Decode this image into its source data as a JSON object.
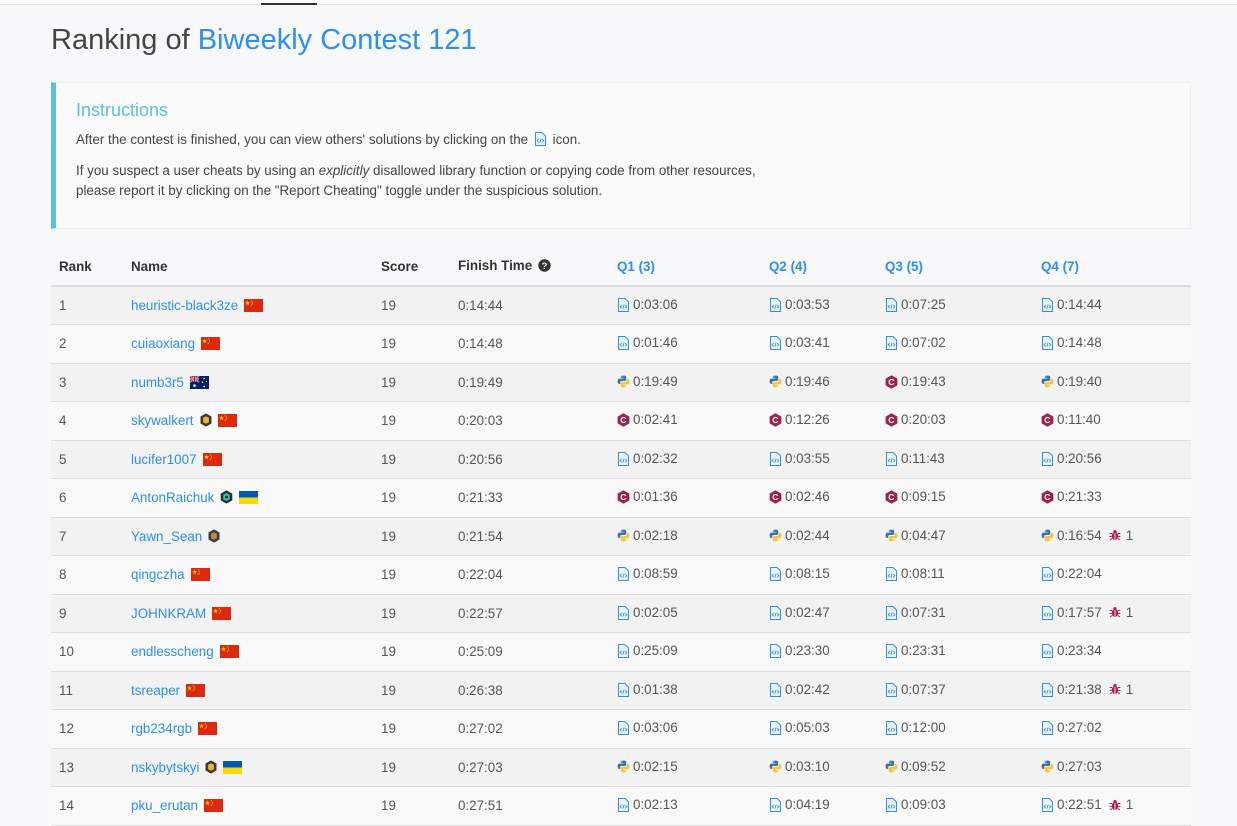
{
  "header": {
    "title_prefix": "Ranking of",
    "contest_name": "Biweekly Contest 121"
  },
  "instructions": {
    "heading": "Instructions",
    "line1_before": "After the contest is finished, you can view others' solutions by clicking on the",
    "line1_after": "icon.",
    "line2_before": "If you suspect a user cheats by using an",
    "line2_em": "explicitly",
    "line2_after": "disallowed library function or copying code from other resources,",
    "line3": "please report it by clicking on the \"Report Cheating\" toggle under the suspicious solution."
  },
  "table": {
    "columns": {
      "rank": "Rank",
      "name": "Name",
      "score": "Score",
      "finish_time": "Finish Time",
      "q1": "Q1 (3)",
      "q2": "Q2 (4)",
      "q3": "Q3 (5)",
      "q4": "Q4 (7)"
    },
    "rows": [
      {
        "rank": "1",
        "name": "heuristic-black3ze",
        "badge": "",
        "flag": "cn",
        "score": "19",
        "finish": "0:14:44",
        "q": [
          {
            "lang": "code",
            "time": "0:03:06"
          },
          {
            "lang": "code",
            "time": "0:03:53"
          },
          {
            "lang": "code",
            "time": "0:07:25"
          },
          {
            "lang": "code",
            "time": "0:14:44"
          }
        ]
      },
      {
        "rank": "2",
        "name": "cuiaoxiang",
        "badge": "",
        "flag": "cn",
        "score": "19",
        "finish": "0:14:48",
        "q": [
          {
            "lang": "code",
            "time": "0:01:46"
          },
          {
            "lang": "code",
            "time": "0:03:41"
          },
          {
            "lang": "code",
            "time": "0:07:02"
          },
          {
            "lang": "code",
            "time": "0:14:48"
          }
        ]
      },
      {
        "rank": "3",
        "name": "numb3r5",
        "badge": "",
        "flag": "au",
        "score": "19",
        "finish": "0:19:49",
        "q": [
          {
            "lang": "python",
            "time": "0:19:49"
          },
          {
            "lang": "python",
            "time": "0:19:46"
          },
          {
            "lang": "cpp",
            "time": "0:19:43"
          },
          {
            "lang": "python",
            "time": "0:19:40"
          }
        ]
      },
      {
        "rank": "4",
        "name": "skywalkert",
        "badge": "guardian",
        "flag": "cn",
        "score": "19",
        "finish": "0:20:03",
        "q": [
          {
            "lang": "cpp",
            "time": "0:02:41"
          },
          {
            "lang": "cpp",
            "time": "0:12:26"
          },
          {
            "lang": "cpp",
            "time": "0:20:03"
          },
          {
            "lang": "cpp",
            "time": "0:11:40"
          }
        ]
      },
      {
        "rank": "5",
        "name": "lucifer1007",
        "badge": "",
        "flag": "cn",
        "score": "19",
        "finish": "0:20:56",
        "q": [
          {
            "lang": "code",
            "time": "0:02:32"
          },
          {
            "lang": "code",
            "time": "0:03:55"
          },
          {
            "lang": "code",
            "time": "0:11:43"
          },
          {
            "lang": "code",
            "time": "0:20:56"
          }
        ]
      },
      {
        "rank": "6",
        "name": "AntonRaichuk",
        "badge": "knight",
        "flag": "ua",
        "score": "19",
        "finish": "0:21:33",
        "q": [
          {
            "lang": "cpp",
            "time": "0:01:36"
          },
          {
            "lang": "cpp",
            "time": "0:02:46"
          },
          {
            "lang": "cpp",
            "time": "0:09:15"
          },
          {
            "lang": "cpp",
            "time": "0:21:33"
          }
        ]
      },
      {
        "rank": "7",
        "name": "Yawn_Sean",
        "badge": "guardian-brown",
        "flag": "",
        "score": "19",
        "finish": "0:21:54",
        "q": [
          {
            "lang": "python",
            "time": "0:02:18"
          },
          {
            "lang": "python",
            "time": "0:02:44"
          },
          {
            "lang": "python",
            "time": "0:04:47"
          },
          {
            "lang": "python",
            "time": "0:16:54",
            "bug": "1"
          }
        ]
      },
      {
        "rank": "8",
        "name": "qingczha",
        "badge": "",
        "flag": "cn",
        "score": "19",
        "finish": "0:22:04",
        "q": [
          {
            "lang": "code",
            "time": "0:08:59"
          },
          {
            "lang": "code",
            "time": "0:08:15"
          },
          {
            "lang": "code",
            "time": "0:08:11"
          },
          {
            "lang": "code",
            "time": "0:22:04"
          }
        ]
      },
      {
        "rank": "9",
        "name": "JOHNKRAM",
        "badge": "",
        "flag": "cn",
        "score": "19",
        "finish": "0:22:57",
        "q": [
          {
            "lang": "code",
            "time": "0:02:05"
          },
          {
            "lang": "code",
            "time": "0:02:47"
          },
          {
            "lang": "code",
            "time": "0:07:31"
          },
          {
            "lang": "code",
            "time": "0:17:57",
            "bug": "1"
          }
        ]
      },
      {
        "rank": "10",
        "name": "endlesscheng",
        "badge": "",
        "flag": "cn",
        "score": "19",
        "finish": "0:25:09",
        "q": [
          {
            "lang": "code",
            "time": "0:25:09"
          },
          {
            "lang": "code",
            "time": "0:23:30"
          },
          {
            "lang": "code",
            "time": "0:23:31"
          },
          {
            "lang": "code",
            "time": "0:23:34"
          }
        ]
      },
      {
        "rank": "11",
        "name": "tsreaper",
        "badge": "",
        "flag": "cn",
        "score": "19",
        "finish": "0:26:38",
        "q": [
          {
            "lang": "code",
            "time": "0:01:38"
          },
          {
            "lang": "code",
            "time": "0:02:42"
          },
          {
            "lang": "code",
            "time": "0:07:37"
          },
          {
            "lang": "code",
            "time": "0:21:38",
            "bug": "1"
          }
        ]
      },
      {
        "rank": "12",
        "name": "rgb234rgb",
        "badge": "",
        "flag": "cn",
        "score": "19",
        "finish": "0:27:02",
        "q": [
          {
            "lang": "code",
            "time": "0:03:06"
          },
          {
            "lang": "code",
            "time": "0:05:03"
          },
          {
            "lang": "code",
            "time": "0:12:00"
          },
          {
            "lang": "code",
            "time": "0:27:02"
          }
        ]
      },
      {
        "rank": "13",
        "name": "nskybytskyi",
        "badge": "guardian",
        "flag": "ua",
        "score": "19",
        "finish": "0:27:03",
        "q": [
          {
            "lang": "python",
            "time": "0:02:15"
          },
          {
            "lang": "python",
            "time": "0:03:10"
          },
          {
            "lang": "python",
            "time": "0:09:52"
          },
          {
            "lang": "python",
            "time": "0:27:03"
          }
        ]
      },
      {
        "rank": "14",
        "name": "pku_erutan",
        "badge": "",
        "flag": "cn",
        "score": "19",
        "finish": "0:27:51",
        "q": [
          {
            "lang": "code",
            "time": "0:02:13"
          },
          {
            "lang": "code",
            "time": "0:04:19"
          },
          {
            "lang": "code",
            "time": "0:09:03"
          },
          {
            "lang": "code",
            "time": "0:22:51",
            "bug": "1"
          }
        ]
      }
    ]
  },
  "colors": {
    "accent": "#2d8ff0",
    "instructions_border": "#5bc0de",
    "cpp_icon": "#9b2450",
    "bug_icon": "#b0204a"
  }
}
